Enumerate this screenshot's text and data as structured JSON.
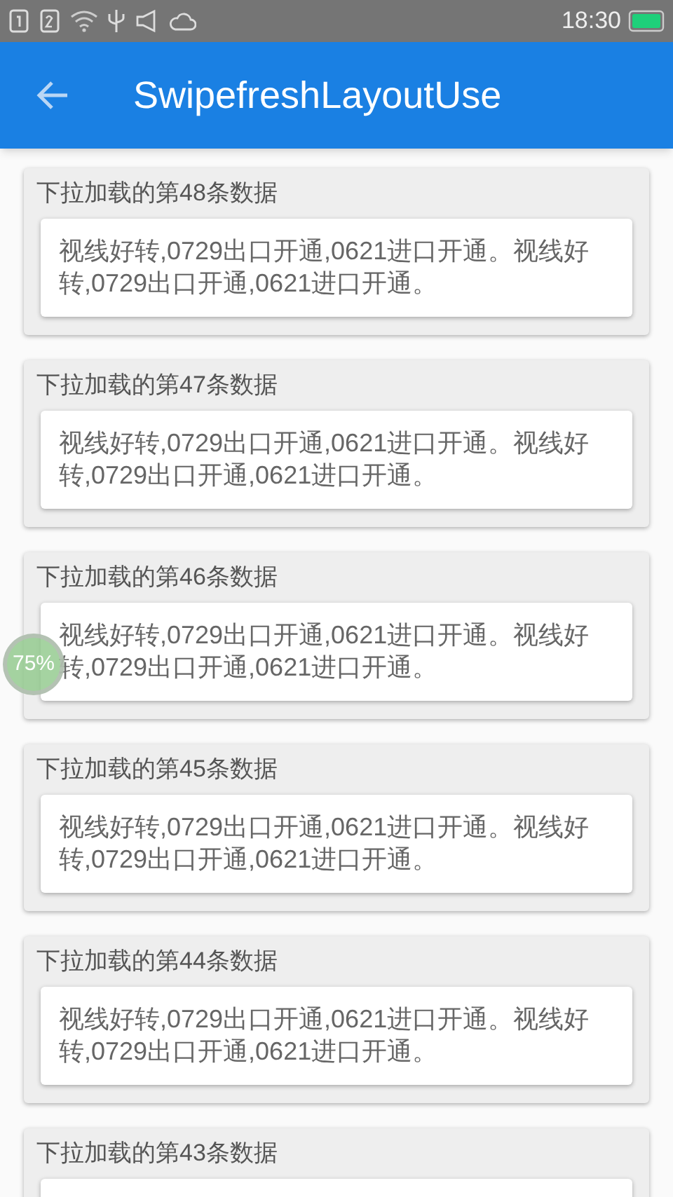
{
  "status_bar": {
    "time": "18:30"
  },
  "app_bar": {
    "title": "SwipefreshLayoutUse"
  },
  "items": [
    {
      "title": "下拉加载的第48条数据",
      "body": "视线好转,0729出口开通,0621进口开通。视线好转,0729出口开通,0621进口开通。"
    },
    {
      "title": "下拉加载的第47条数据",
      "body": "视线好转,0729出口开通,0621进口开通。视线好转,0729出口开通,0621进口开通。"
    },
    {
      "title": "下拉加载的第46条数据",
      "body": "视线好转,0729出口开通,0621进口开通。视线好转,0729出口开通,0621进口开通。"
    },
    {
      "title": "下拉加载的第45条数据",
      "body": "视线好转,0729出口开通,0621进口开通。视线好转,0729出口开通,0621进口开通。"
    },
    {
      "title": "下拉加载的第44条数据",
      "body": "视线好转,0729出口开通,0621进口开通。视线好转,0729出口开通,0621进口开通。"
    },
    {
      "title": "下拉加载的第43条数据"
    }
  ],
  "floating_badge": {
    "text": "75%"
  }
}
